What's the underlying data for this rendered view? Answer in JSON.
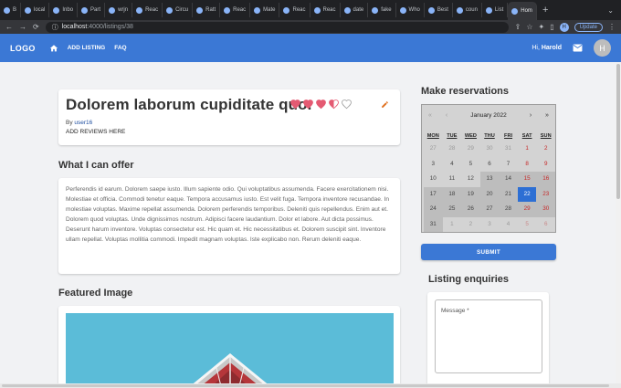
{
  "browser": {
    "tabs": [
      {
        "label": "B"
      },
      {
        "label": "local"
      },
      {
        "label": "Inbo"
      },
      {
        "label": "Part"
      },
      {
        "label": "wrjn"
      },
      {
        "label": "Reac"
      },
      {
        "label": "Circu"
      },
      {
        "label": "Ratt"
      },
      {
        "label": "Reac"
      },
      {
        "label": "Mate"
      },
      {
        "label": "Reac"
      },
      {
        "label": "Reac"
      },
      {
        "label": "date"
      },
      {
        "label": "fake"
      },
      {
        "label": "Who"
      },
      {
        "label": "Best"
      },
      {
        "label": "coun"
      },
      {
        "label": "List"
      },
      {
        "label": "Hom"
      }
    ],
    "url_host": "localhost",
    "url_path": ":4000/listings/38",
    "profile_initial": "H",
    "update_label": "Update"
  },
  "nav": {
    "logo": "LOGO",
    "links": [
      "ADD LISTING",
      "FAQ"
    ],
    "greeting_prefix": "Hi, ",
    "user_name": "Harold",
    "avatar_initial": "H",
    "accent_color": "#3b78d5"
  },
  "listing": {
    "title": "Dolorem laborum cupiditate quo.",
    "rating": 3.5,
    "rating_max": 5,
    "by_prefix": "By ",
    "author": "user16",
    "add_reviews": "ADD REVIEWS HERE"
  },
  "offer": {
    "heading": "What I can offer",
    "text": "Perferendis id earum. Dolorem saepe iusto. Illum sapiente odio. Qui voluptatibus assumenda. Facere exercitationem nisi. Molestiae et officia. Commodi tenetur eaque. Tempora accusamus iusto. Est velit fuga. Tempora inventore recusandae. In molestiae voluptas. Maxime repellat assumenda. Dolorem perferendis temporibus. Deleniti quis repellendus. Enim aut et. Dolorem quod voluptas. Unde dignissimos nostrum. Adipisci facere laudantium. Dolor et labore. Aut dicta possimus. Deserunt harum inventore. Voluptas consectetur est. Hic quam et. Hic necessitatibus et. Dolorem suscipit sint. Inventore ullam repellat. Voluptas mollitia commodi. Impedit magnam voluptas. Iste explicabo non. Rerum deleniti eaque."
  },
  "featured": {
    "heading": "Featured Image"
  },
  "reservations": {
    "heading": "Make reservations",
    "calendar": {
      "month_label": "January 2022",
      "prev_year": "«",
      "prev_month": "‹",
      "next_month": "›",
      "next_year": "»",
      "weekdays": [
        "MON",
        "TUE",
        "WED",
        "THU",
        "FRI",
        "SAT",
        "SUN"
      ],
      "days": [
        {
          "d": "27",
          "t": "other"
        },
        {
          "d": "28",
          "t": "other"
        },
        {
          "d": "29",
          "t": "other"
        },
        {
          "d": "30",
          "t": "other"
        },
        {
          "d": "31",
          "t": "other"
        },
        {
          "d": "1",
          "t": "weekend"
        },
        {
          "d": "2",
          "t": "weekend"
        },
        {
          "d": "3",
          "t": "past"
        },
        {
          "d": "4",
          "t": "past"
        },
        {
          "d": "5",
          "t": "past"
        },
        {
          "d": "6",
          "t": "past"
        },
        {
          "d": "7",
          "t": "past"
        },
        {
          "d": "8",
          "t": "weekend"
        },
        {
          "d": "9",
          "t": "weekend"
        },
        {
          "d": "10",
          "t": "past"
        },
        {
          "d": "11",
          "t": "past"
        },
        {
          "d": "12",
          "t": "past"
        },
        {
          "d": "13",
          "t": "avail"
        },
        {
          "d": "14",
          "t": "avail"
        },
        {
          "d": "15",
          "t": "avail weekend"
        },
        {
          "d": "16",
          "t": "avail weekend"
        },
        {
          "d": "17",
          "t": "avail"
        },
        {
          "d": "18",
          "t": "avail"
        },
        {
          "d": "19",
          "t": "avail"
        },
        {
          "d": "20",
          "t": "avail"
        },
        {
          "d": "21",
          "t": "avail"
        },
        {
          "d": "22",
          "t": "today"
        },
        {
          "d": "23",
          "t": "avail weekend"
        },
        {
          "d": "24",
          "t": "avail"
        },
        {
          "d": "25",
          "t": "avail"
        },
        {
          "d": "26",
          "t": "avail"
        },
        {
          "d": "27",
          "t": "avail"
        },
        {
          "d": "28",
          "t": "avail"
        },
        {
          "d": "29",
          "t": "avail weekend"
        },
        {
          "d": "30",
          "t": "avail weekend"
        },
        {
          "d": "31",
          "t": "avail"
        },
        {
          "d": "1",
          "t": "other"
        },
        {
          "d": "2",
          "t": "other"
        },
        {
          "d": "3",
          "t": "other"
        },
        {
          "d": "4",
          "t": "other"
        },
        {
          "d": "5",
          "t": "other weekend"
        },
        {
          "d": "6",
          "t": "other weekend"
        }
      ]
    },
    "submit_label": "SUBMIT"
  },
  "enquiries": {
    "heading": "Listing enquiries",
    "message_label": "Message *"
  }
}
